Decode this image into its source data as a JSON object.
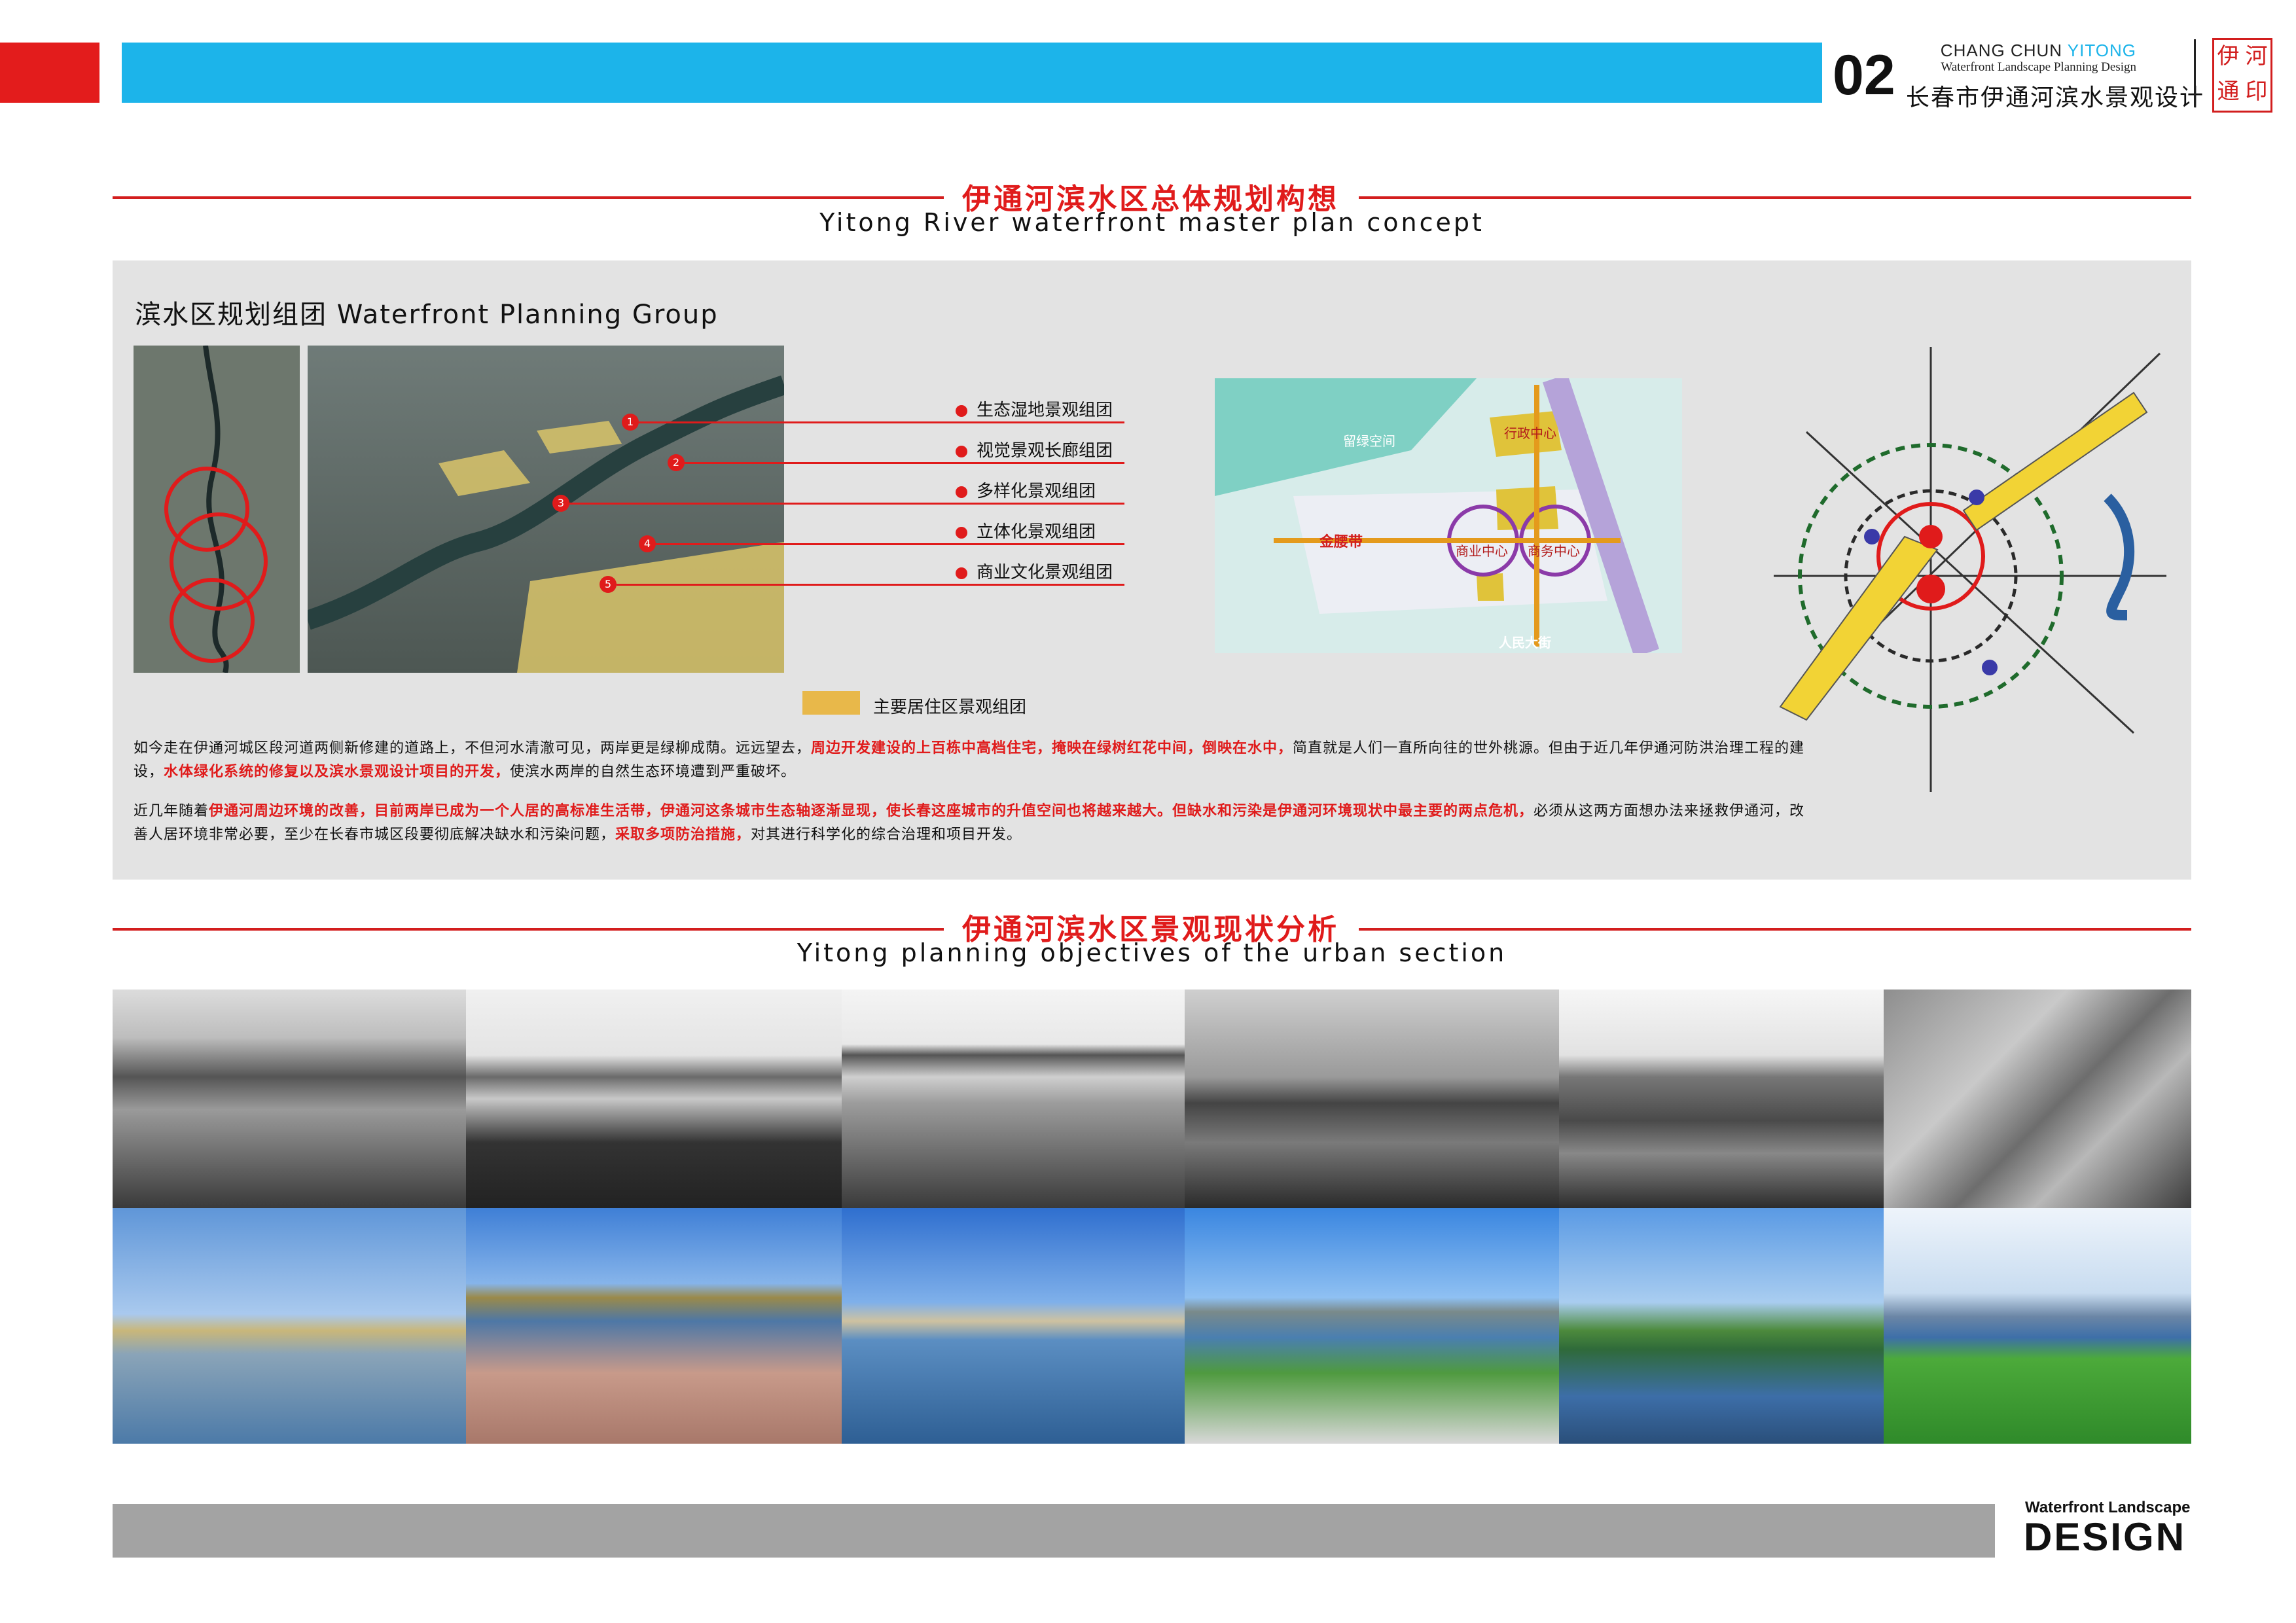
{
  "header": {
    "city_prefix": "CHANG CHUN",
    "city_accent": "YITONG",
    "subtitle_en": "Waterfront Landscape Planning Design",
    "page_number": "02",
    "title_zh": "长春市伊通河滨水景观设计",
    "seal_chars": [
      "河",
      "伊",
      "印",
      "通"
    ]
  },
  "section1": {
    "title_zh": "伊通河滨水区总体规划构想",
    "title_en": "Yitong River waterfront master plan concept"
  },
  "panel": {
    "title": "滨水区规划组团 Waterfront Planning Group",
    "groups": [
      {
        "num": "1",
        "label": "生态湿地景观组团"
      },
      {
        "num": "2",
        "label": "视觉景观长廊组团"
      },
      {
        "num": "3",
        "label": "多样化景观组团"
      },
      {
        "num": "4",
        "label": "立体化景观组团"
      },
      {
        "num": "5",
        "label": "商业文化景观组团"
      }
    ],
    "residential_legend": "主要居住区景观组团",
    "map_labels": {
      "green": "留绿空间",
      "admin": "行政中心",
      "gold_belt": "金腰带",
      "commercial": "商业中心",
      "business": "商务中心",
      "avenue": "人民大街"
    },
    "paragraph1": [
      {
        "t": "如今走在伊通河城区段河道两侧新修建的道路上，不但河水清澈可见，两岸更是绿柳成荫。远远望去，",
        "red": false
      },
      {
        "t": "周边开发建设的上百栋中高档住宅，掩映在绿树红花中间，倒映在水中，",
        "red": true
      },
      {
        "t": "简直就是人们一直所向往的世外桃源。但由于近几年伊通河防洪治理工程的建设，",
        "red": false
      },
      {
        "t": "水体绿化系统的修复以及滨水景观设计项目的开发，",
        "red": true
      },
      {
        "t": "使滨水两岸的自然生态环境遭到严重破坏。",
        "red": false
      }
    ],
    "paragraph2": [
      {
        "t": "近几年随着",
        "red": false
      },
      {
        "t": "伊通河周边环境的改善，目前两岸已成为一个人居的高标准生活带，伊通河这条城市生态轴逐渐显现，使长春这座城市的升值空间也将越来越大。但缺水和污染是伊通河环境现状中最主要的两点危机，",
        "red": true
      },
      {
        "t": "必须从这两方面想办法来拯救伊通河，改善人居环境非常必要，至少在长春市城区段要彻底解决缺水和污染问题，",
        "red": false
      },
      {
        "t": "采取多项防治措施，",
        "red": true
      },
      {
        "t": "对其进行科学化的综合治理和项目开发。",
        "red": false
      }
    ]
  },
  "section2": {
    "title_zh": "伊通河滨水区景观现状分析",
    "title_en": "Yitong planning objectives of the urban section"
  },
  "footer": {
    "sub": "Waterfront Landscape",
    "big": "DESIGN"
  },
  "colors": {
    "accent_red": "#e31c1c",
    "accent_blue": "#1cb4ea",
    "panel_grey": "#e3e3e3",
    "footer_grey": "#a3a3a3",
    "residential_yellow": "#e8b84a"
  }
}
